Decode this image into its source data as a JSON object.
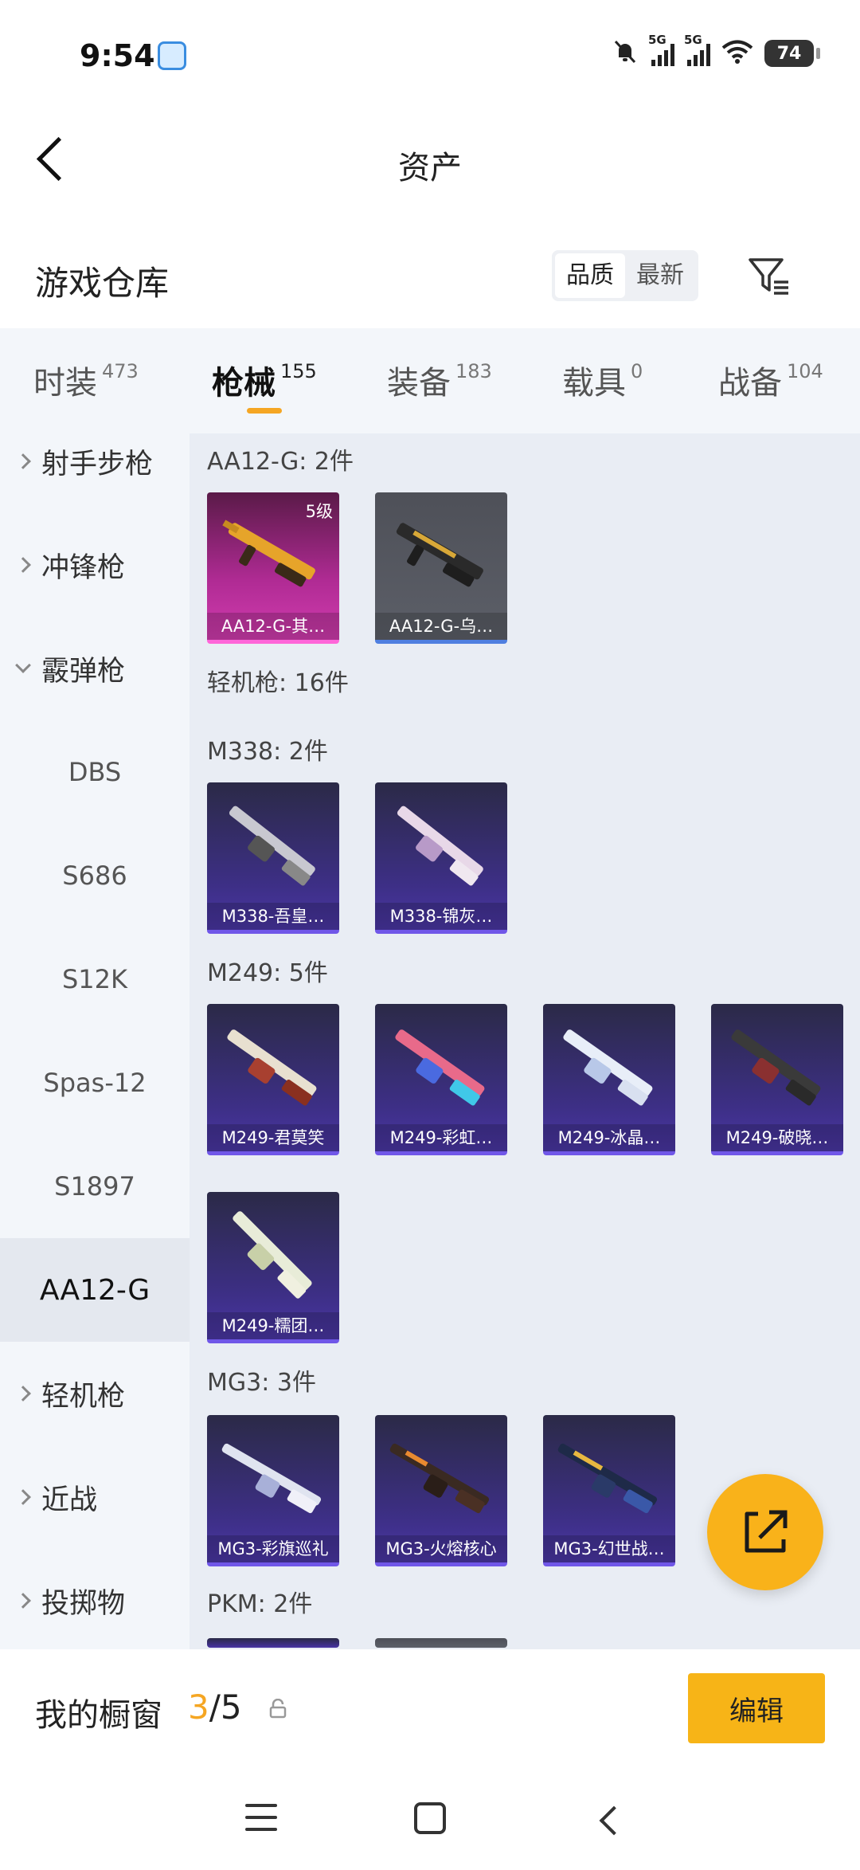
{
  "status_bar": {
    "time": "9:54",
    "sim1": "5G",
    "sim2": "5G",
    "battery": "74"
  },
  "header": {
    "title": "资产"
  },
  "warehouse": {
    "title": "游戏仓库",
    "sort_options": [
      "品质",
      "最新"
    ],
    "sort_selected": "品质"
  },
  "tabs": [
    {
      "label": "时装",
      "count": "473"
    },
    {
      "label": "枪械",
      "count": "155"
    },
    {
      "label": "装备",
      "count": "183"
    },
    {
      "label": "载具",
      "count": "0"
    },
    {
      "label": "战备",
      "count": "104"
    }
  ],
  "active_tab": "枪械",
  "sidebar": {
    "items": [
      {
        "label": "射手步枪"
      },
      {
        "label": "冲锋枪"
      },
      {
        "label": "霰弹枪"
      },
      {
        "label": "DBS"
      },
      {
        "label": "S686"
      },
      {
        "label": "S12K"
      },
      {
        "label": "Spas-12"
      },
      {
        "label": "S1897"
      },
      {
        "label": "AA12-G"
      },
      {
        "label": "轻机枪"
      },
      {
        "label": "近战"
      },
      {
        "label": "投掷物"
      }
    ],
    "active": "AA12-G"
  },
  "content": {
    "sections": [
      {
        "heading": "AA12-G: 2件",
        "items": [
          {
            "name": "AA12-G-其…",
            "level": "5级",
            "style": "pink"
          },
          {
            "name": "AA12-G-乌…",
            "style": "gray"
          }
        ]
      },
      {
        "heading": "轻机枪: 16件"
      },
      {
        "heading": "M338: 2件",
        "items": [
          {
            "name": "M338-吾皇…"
          },
          {
            "name": "M338-锦灰…"
          }
        ]
      },
      {
        "heading": "M249: 5件",
        "items": [
          {
            "name": "M249-君莫笑"
          },
          {
            "name": "M249-彩虹…"
          },
          {
            "name": "M249-冰晶…"
          },
          {
            "name": "M249-破晓…"
          },
          {
            "name": "M249-糯团…"
          }
        ]
      },
      {
        "heading": "MG3: 3件",
        "items": [
          {
            "name": "MG3-彩旗巡礼"
          },
          {
            "name": "MG3-火熔核心"
          },
          {
            "name": "MG3-幻世战…"
          }
        ]
      },
      {
        "heading": "PKM: 2件"
      }
    ]
  },
  "showcase": {
    "title": "我的橱窗",
    "current": "3",
    "separator": "/5",
    "edit_label": "编辑"
  },
  "colors": {
    "accent": "#f5a623",
    "card_purple": "#3d2f86",
    "card_pink": "#d13cae",
    "card_gray": "#5c5f68"
  }
}
